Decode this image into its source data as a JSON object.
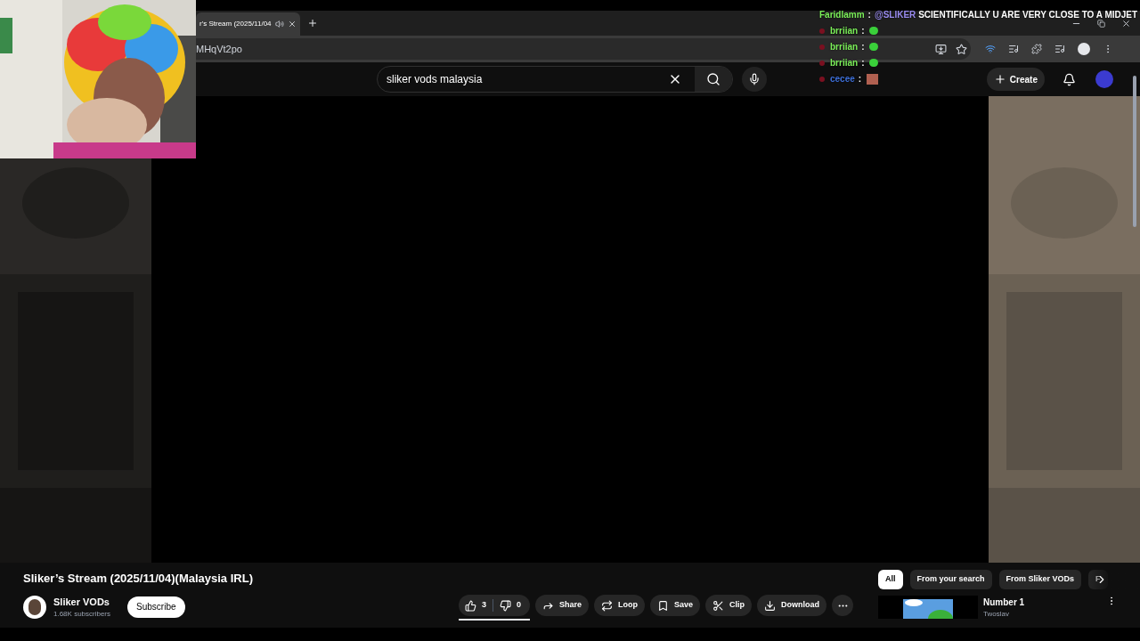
{
  "browser": {
    "tab_title": "r's Stream (2025/11/04",
    "url": "MHqVt2po"
  },
  "search": {
    "value": "sliker vods malaysia"
  },
  "header": {
    "create": "Create"
  },
  "chat": [
    {
      "kind": "text",
      "user": "Faridlamm",
      "color": "#7cf05a",
      "separator": ":",
      "mention": "@SLIKER",
      "message": "SCIENTIFICALLY U ARE VERY CLOSE TO A MIDJET"
    },
    {
      "kind": "emote",
      "user": "brriian",
      "separator": ":",
      "color": "#7cf05a"
    },
    {
      "kind": "emote",
      "user": "brriian",
      "separator": ":",
      "color": "#7cf05a"
    },
    {
      "kind": "emote",
      "user": "brriian",
      "separator": ":",
      "color": "#7cf05a"
    },
    {
      "kind": "picture-emote",
      "user": "cecee",
      "separator": ":",
      "color": "#3d6fd8"
    }
  ],
  "video": {
    "title": "Sliker’s Stream (2025/11/04)(Malaysia IRL)",
    "channel": "Sliker VODs",
    "subscribers": "1.68K subscribers",
    "subscribe": "Subscribe",
    "likes": "3",
    "dislikes": "0",
    "actions": [
      {
        "kind": "share",
        "label": "Share"
      },
      {
        "kind": "loop",
        "label": "Loop"
      },
      {
        "kind": "save",
        "label": "Save"
      },
      {
        "kind": "clip",
        "label": "Clip"
      },
      {
        "kind": "download",
        "label": "Download"
      }
    ]
  },
  "chips": [
    {
      "label": "All",
      "selected": true
    },
    {
      "label": "From your search",
      "selected": false
    },
    {
      "label": "From Sliker VODs",
      "selected": false
    },
    {
      "label": "F",
      "selected": false
    }
  ],
  "recommendations": [
    {
      "title": "Number 1",
      "channel": "Twoslav"
    }
  ]
}
